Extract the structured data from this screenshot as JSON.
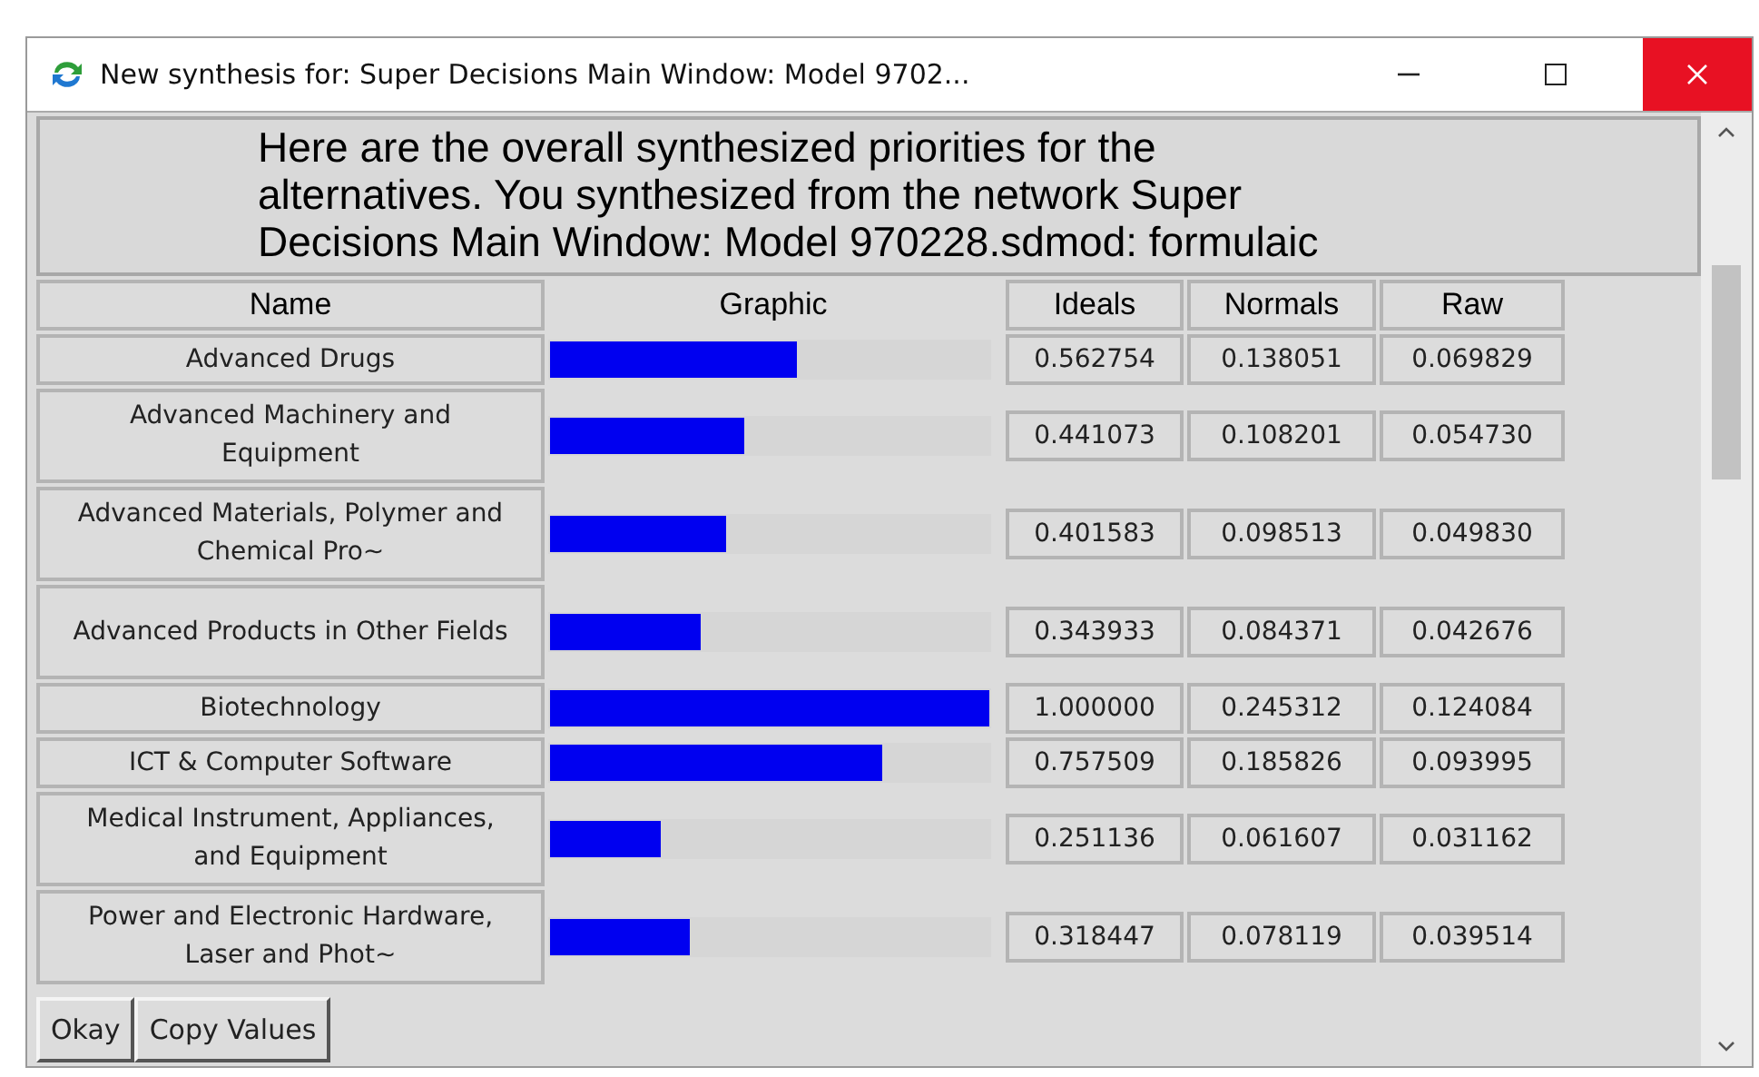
{
  "window": {
    "title": "New synthesis for: Super Decisions Main Window: Model 9702..."
  },
  "message": "Here are the overall synthesized priorities for the alternatives.  You synthesized from the network Super Decisions Main Window: Model 970228.sdmod: formulaic",
  "table": {
    "columns": [
      "Name",
      "Graphic",
      "Ideals",
      "Normals",
      "Raw"
    ],
    "rows": [
      {
        "name": "Advanced Drugs",
        "level": 0.562754,
        "ideals": "0.562754",
        "normals": "0.138051",
        "raw": "0.069829"
      },
      {
        "name": "Advanced Machinery and Equipment",
        "level": 0.441073,
        "ideals": "0.441073",
        "normals": "0.108201",
        "raw": "0.054730"
      },
      {
        "name": "Advanced Materials, Polymer and Chemical Pro~",
        "level": 0.401583,
        "ideals": "0.401583",
        "normals": "0.098513",
        "raw": "0.049830"
      },
      {
        "name": "Advanced Products in Other Fields",
        "level": 0.343933,
        "ideals": "0.343933",
        "normals": "0.084371",
        "raw": "0.042676"
      },
      {
        "name": "Biotechnology",
        "level": 1.0,
        "ideals": "1.000000",
        "normals": "0.245312",
        "raw": "0.124084"
      },
      {
        "name": "ICT & Computer Software",
        "level": 0.757509,
        "ideals": "0.757509",
        "normals": "0.185826",
        "raw": "0.093995"
      },
      {
        "name": "Medical Instrument, Appliances, and Equipment",
        "level": 0.251136,
        "ideals": "0.251136",
        "normals": "0.061607",
        "raw": "0.031162"
      },
      {
        "name": "Power and Electronic Hardware, Laser and Phot~",
        "level": 0.318447,
        "ideals": "0.318447",
        "normals": "0.078119",
        "raw": "0.039514"
      }
    ]
  },
  "buttons": [
    "Okay",
    "Copy Values"
  ]
}
